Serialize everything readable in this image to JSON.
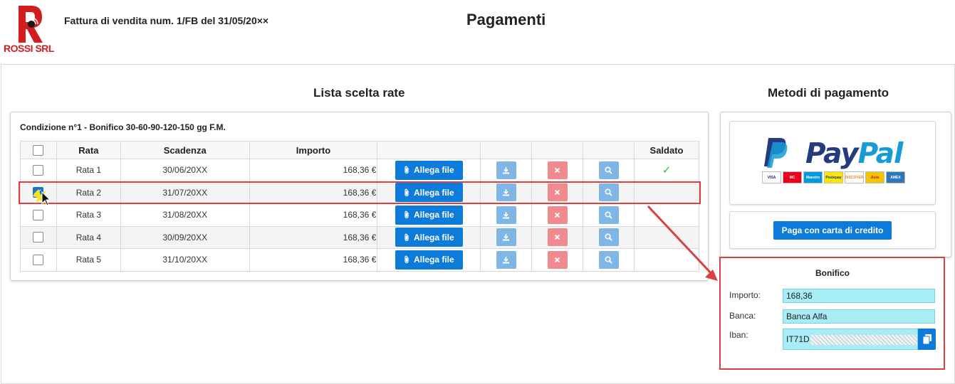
{
  "header": {
    "logo_text": "ROSSI SRL",
    "invoice_title": "Fattura di vendita num. 1/FB del 31/05/20××",
    "page_title": "Pagamenti"
  },
  "left": {
    "title": "Lista scelta rate",
    "condition": "Condizione n°1 - Bonifico 30-60-90-120-150 gg F.M.",
    "columns": [
      "",
      "Rata",
      "Scadenza",
      "Importo",
      "",
      "",
      "",
      "",
      "Saldato"
    ],
    "rows": [
      {
        "rata": "Rata 1",
        "scadenza": "30/06/20XX",
        "importo": "168,36 €",
        "attach": "Allega file",
        "checked": false,
        "saldato": true
      },
      {
        "rata": "Rata 2",
        "scadenza": "31/07/20XX",
        "importo": "168,36 €",
        "attach": "Allega file",
        "checked": true,
        "saldato": false
      },
      {
        "rata": "Rata 3",
        "scadenza": "31/08/20XX",
        "importo": "168,36 €",
        "attach": "Allega file",
        "checked": false,
        "saldato": false
      },
      {
        "rata": "Rata 4",
        "scadenza": "30/09/20XX",
        "importo": "168,36 €",
        "attach": "Allega file",
        "checked": false,
        "saldato": false
      },
      {
        "rata": "Rata 5",
        "scadenza": "31/10/20XX",
        "importo": "168,36 €",
        "attach": "Allega file",
        "checked": false,
        "saldato": false
      }
    ]
  },
  "right": {
    "title": "Metodi di pagamento",
    "paypal": {
      "pay": "Pay",
      "pal": "Pal"
    },
    "cards": [
      "VISA",
      "MC",
      "Maestro",
      "Postepay",
      "DISCOVER",
      "Aura",
      "AMEX"
    ],
    "pay_card_label": "Paga con carta di credito",
    "bonifico": {
      "title": "Bonifico",
      "importo_label": "Importo:",
      "importo_value": "168,36",
      "banca_label": "Banca:",
      "banca_value": "Banca Alfa",
      "iban_label": "Iban:",
      "iban_value": "IT71D"
    }
  },
  "colors": {
    "primary": "#0d7bd9",
    "danger": "#f08a8f",
    "light_primary": "#7fb6e6",
    "highlight": "#d9403f",
    "field_bg": "#a8ecf6",
    "paypal_dark": "#253b80",
    "paypal_light": "#179bd7"
  }
}
